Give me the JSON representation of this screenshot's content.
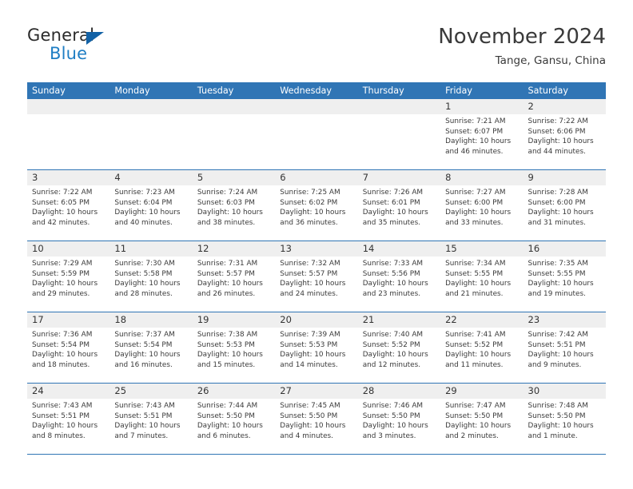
{
  "brand": {
    "name_part1": "General",
    "name_part2": "Blue",
    "logo_icon": "blue-triangle-icon",
    "accent_color": "#1f7ec4"
  },
  "header": {
    "title": "November 2024",
    "location": "Tange, Gansu, China"
  },
  "calendar": {
    "header_color": "#3075b5",
    "daynum_strip_color": "#efefef",
    "weekdays": [
      "Sunday",
      "Monday",
      "Tuesday",
      "Wednesday",
      "Thursday",
      "Friday",
      "Saturday"
    ],
    "weeks": [
      [
        {
          "day": "",
          "sunrise": "",
          "sunset": "",
          "daylight": "",
          "empty": true
        },
        {
          "day": "",
          "sunrise": "",
          "sunset": "",
          "daylight": "",
          "empty": true
        },
        {
          "day": "",
          "sunrise": "",
          "sunset": "",
          "daylight": "",
          "empty": true
        },
        {
          "day": "",
          "sunrise": "",
          "sunset": "",
          "daylight": "",
          "empty": true
        },
        {
          "day": "",
          "sunrise": "",
          "sunset": "",
          "daylight": "",
          "empty": true
        },
        {
          "day": "1",
          "sunrise": "Sunrise: 7:21 AM",
          "sunset": "Sunset: 6:07 PM",
          "daylight": "Daylight: 10 hours and 46 minutes.",
          "empty": false
        },
        {
          "day": "2",
          "sunrise": "Sunrise: 7:22 AM",
          "sunset": "Sunset: 6:06 PM",
          "daylight": "Daylight: 10 hours and 44 minutes.",
          "empty": false
        }
      ],
      [
        {
          "day": "3",
          "sunrise": "Sunrise: 7:22 AM",
          "sunset": "Sunset: 6:05 PM",
          "daylight": "Daylight: 10 hours and 42 minutes.",
          "empty": false
        },
        {
          "day": "4",
          "sunrise": "Sunrise: 7:23 AM",
          "sunset": "Sunset: 6:04 PM",
          "daylight": "Daylight: 10 hours and 40 minutes.",
          "empty": false
        },
        {
          "day": "5",
          "sunrise": "Sunrise: 7:24 AM",
          "sunset": "Sunset: 6:03 PM",
          "daylight": "Daylight: 10 hours and 38 minutes.",
          "empty": false
        },
        {
          "day": "6",
          "sunrise": "Sunrise: 7:25 AM",
          "sunset": "Sunset: 6:02 PM",
          "daylight": "Daylight: 10 hours and 36 minutes.",
          "empty": false
        },
        {
          "day": "7",
          "sunrise": "Sunrise: 7:26 AM",
          "sunset": "Sunset: 6:01 PM",
          "daylight": "Daylight: 10 hours and 35 minutes.",
          "empty": false
        },
        {
          "day": "8",
          "sunrise": "Sunrise: 7:27 AM",
          "sunset": "Sunset: 6:00 PM",
          "daylight": "Daylight: 10 hours and 33 minutes.",
          "empty": false
        },
        {
          "day": "9",
          "sunrise": "Sunrise: 7:28 AM",
          "sunset": "Sunset: 6:00 PM",
          "daylight": "Daylight: 10 hours and 31 minutes.",
          "empty": false
        }
      ],
      [
        {
          "day": "10",
          "sunrise": "Sunrise: 7:29 AM",
          "sunset": "Sunset: 5:59 PM",
          "daylight": "Daylight: 10 hours and 29 minutes.",
          "empty": false
        },
        {
          "day": "11",
          "sunrise": "Sunrise: 7:30 AM",
          "sunset": "Sunset: 5:58 PM",
          "daylight": "Daylight: 10 hours and 28 minutes.",
          "empty": false
        },
        {
          "day": "12",
          "sunrise": "Sunrise: 7:31 AM",
          "sunset": "Sunset: 5:57 PM",
          "daylight": "Daylight: 10 hours and 26 minutes.",
          "empty": false
        },
        {
          "day": "13",
          "sunrise": "Sunrise: 7:32 AM",
          "sunset": "Sunset: 5:57 PM",
          "daylight": "Daylight: 10 hours and 24 minutes.",
          "empty": false
        },
        {
          "day": "14",
          "sunrise": "Sunrise: 7:33 AM",
          "sunset": "Sunset: 5:56 PM",
          "daylight": "Daylight: 10 hours and 23 minutes.",
          "empty": false
        },
        {
          "day": "15",
          "sunrise": "Sunrise: 7:34 AM",
          "sunset": "Sunset: 5:55 PM",
          "daylight": "Daylight: 10 hours and 21 minutes.",
          "empty": false
        },
        {
          "day": "16",
          "sunrise": "Sunrise: 7:35 AM",
          "sunset": "Sunset: 5:55 PM",
          "daylight": "Daylight: 10 hours and 19 minutes.",
          "empty": false
        }
      ],
      [
        {
          "day": "17",
          "sunrise": "Sunrise: 7:36 AM",
          "sunset": "Sunset: 5:54 PM",
          "daylight": "Daylight: 10 hours and 18 minutes.",
          "empty": false
        },
        {
          "day": "18",
          "sunrise": "Sunrise: 7:37 AM",
          "sunset": "Sunset: 5:54 PM",
          "daylight": "Daylight: 10 hours and 16 minutes.",
          "empty": false
        },
        {
          "day": "19",
          "sunrise": "Sunrise: 7:38 AM",
          "sunset": "Sunset: 5:53 PM",
          "daylight": "Daylight: 10 hours and 15 minutes.",
          "empty": false
        },
        {
          "day": "20",
          "sunrise": "Sunrise: 7:39 AM",
          "sunset": "Sunset: 5:53 PM",
          "daylight": "Daylight: 10 hours and 14 minutes.",
          "empty": false
        },
        {
          "day": "21",
          "sunrise": "Sunrise: 7:40 AM",
          "sunset": "Sunset: 5:52 PM",
          "daylight": "Daylight: 10 hours and 12 minutes.",
          "empty": false
        },
        {
          "day": "22",
          "sunrise": "Sunrise: 7:41 AM",
          "sunset": "Sunset: 5:52 PM",
          "daylight": "Daylight: 10 hours and 11 minutes.",
          "empty": false
        },
        {
          "day": "23",
          "sunrise": "Sunrise: 7:42 AM",
          "sunset": "Sunset: 5:51 PM",
          "daylight": "Daylight: 10 hours and 9 minutes.",
          "empty": false
        }
      ],
      [
        {
          "day": "24",
          "sunrise": "Sunrise: 7:43 AM",
          "sunset": "Sunset: 5:51 PM",
          "daylight": "Daylight: 10 hours and 8 minutes.",
          "empty": false
        },
        {
          "day": "25",
          "sunrise": "Sunrise: 7:43 AM",
          "sunset": "Sunset: 5:51 PM",
          "daylight": "Daylight: 10 hours and 7 minutes.",
          "empty": false
        },
        {
          "day": "26",
          "sunrise": "Sunrise: 7:44 AM",
          "sunset": "Sunset: 5:50 PM",
          "daylight": "Daylight: 10 hours and 6 minutes.",
          "empty": false
        },
        {
          "day": "27",
          "sunrise": "Sunrise: 7:45 AM",
          "sunset": "Sunset: 5:50 PM",
          "daylight": "Daylight: 10 hours and 4 minutes.",
          "empty": false
        },
        {
          "day": "28",
          "sunrise": "Sunrise: 7:46 AM",
          "sunset": "Sunset: 5:50 PM",
          "daylight": "Daylight: 10 hours and 3 minutes.",
          "empty": false
        },
        {
          "day": "29",
          "sunrise": "Sunrise: 7:47 AM",
          "sunset": "Sunset: 5:50 PM",
          "daylight": "Daylight: 10 hours and 2 minutes.",
          "empty": false
        },
        {
          "day": "30",
          "sunrise": "Sunrise: 7:48 AM",
          "sunset": "Sunset: 5:50 PM",
          "daylight": "Daylight: 10 hours and 1 minute.",
          "empty": false
        }
      ]
    ]
  }
}
